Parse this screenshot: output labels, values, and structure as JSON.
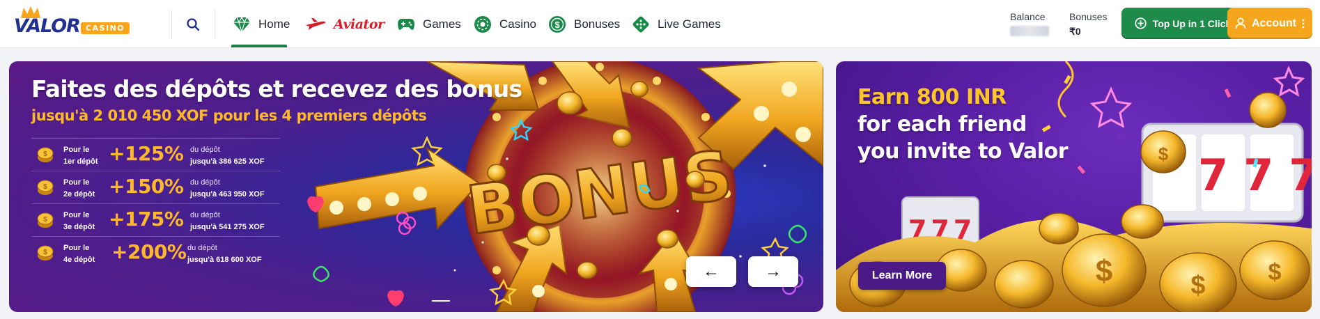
{
  "brand": {
    "name": "VALOR",
    "tag": "CASINO",
    "primary": "#22308e",
    "accent": "#f7a51b"
  },
  "header": {
    "search_icon": "search-icon",
    "nav": [
      {
        "label": "Home",
        "icon": "diamond-icon",
        "active": true
      },
      {
        "label": "Aviator",
        "icon": "airplane-icon"
      },
      {
        "label": "Games",
        "icon": "gamepad-icon"
      },
      {
        "label": "Casino",
        "icon": "roulette-chip-icon"
      },
      {
        "label": "Bonuses",
        "icon": "dollar-coin-icon"
      },
      {
        "label": "Live Games",
        "icon": "dice-icon"
      }
    ],
    "balance_label": "Balance",
    "bonuses_label": "Bonuses",
    "bonuses_value": "₹0",
    "topup_label": "Top Up in 1 Click",
    "account_label": "Account"
  },
  "promo": {
    "title": "Faites des dépôts et recevez des bonus",
    "subtitle": "jusqu'à 2 010 450 XOF pour les 4 premiers dépôts",
    "deposits": [
      {
        "line1": "Pour le",
        "line2": "1er dépôt",
        "percent": "+125%",
        "of": "du dépôt",
        "amount": "jusqu'à 386 625 XOF"
      },
      {
        "line1": "Pour le",
        "line2": "2e dépôt",
        "percent": "+150%",
        "of": "du dépôt",
        "amount": "jusqu'à 463 950 XOF"
      },
      {
        "line1": "Pour le",
        "line2": "3e dépôt",
        "percent": "+175%",
        "of": "du dépôt",
        "amount": "jusqu'à 541 275 XOF"
      },
      {
        "line1": "Pour le",
        "line2": "4e dépôt",
        "percent": "+200%",
        "of": "du dépôt",
        "amount": "jusqu'à 618 600 XOF"
      }
    ],
    "art_text": "BONUS",
    "prev_arrow": "←",
    "next_arrow": "→"
  },
  "referral": {
    "title_highlight": "Earn 800 INR",
    "title_line2": "for each friend",
    "title_line3": "you invite to Valor",
    "button_label": "Learn More",
    "slot_digits": "777"
  }
}
